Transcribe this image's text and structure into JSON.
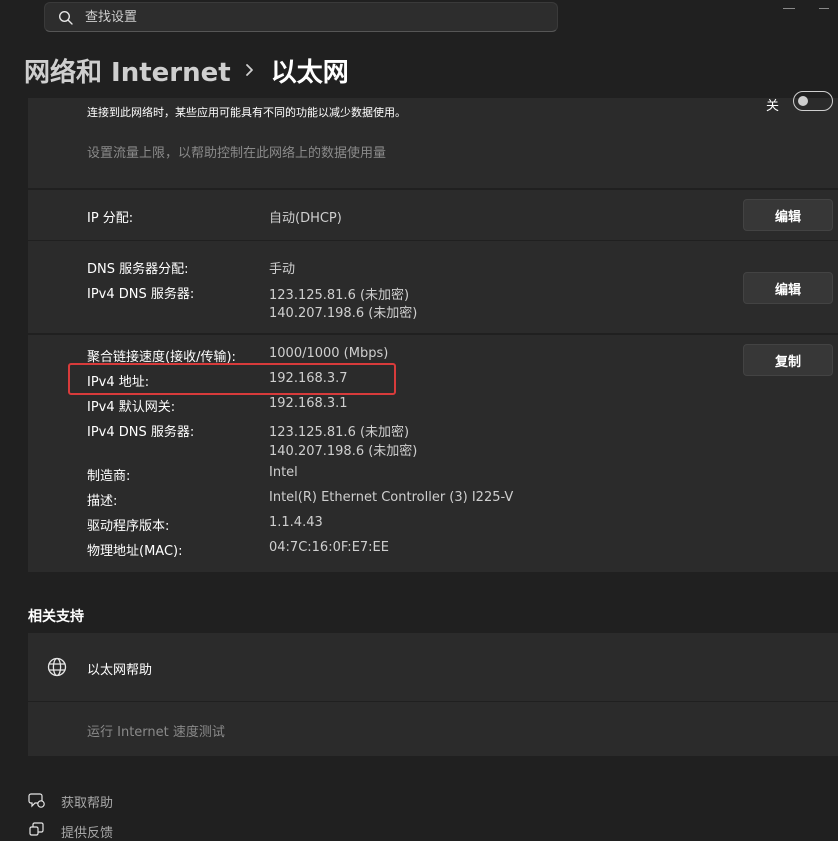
{
  "search": {
    "placeholder": "查找设置",
    "icon": "search-icon"
  },
  "breadcrumb": {
    "parent": "网络和 Internet",
    "separator_icon": "chevron-right-icon",
    "current": "以太网"
  },
  "metered": {
    "description": "连接到此网络时，某些应用可能具有不同的功能以减少数据使用。",
    "toggle_state_label": "关",
    "toggle_on": false,
    "data_limit_link": "设置流量上限，以帮助控制在此网络上的数据使用量"
  },
  "ip_assignment": {
    "label": "IP 分配:",
    "value": "自动(DHCP)",
    "edit_label": "编辑"
  },
  "dns_assignment": {
    "label": "DNS 服务器分配:",
    "value": "手动",
    "ipv4_dns_label": "IPv4 DNS 服务器:",
    "ipv4_dns_values": [
      "123.125.81.6 (未加密)",
      "140.207.198.6 (未加密)"
    ],
    "edit_label": "编辑"
  },
  "properties": {
    "copy_label": "复制",
    "highlight_color": "#d83b3b",
    "rows": [
      {
        "label": "聚合链接速度(接收/传输):",
        "value": "1000/1000 (Mbps)"
      },
      {
        "label": "IPv4 地址:",
        "value": "192.168.3.7"
      },
      {
        "label": "IPv4 默认网关:",
        "value": "192.168.3.1"
      },
      {
        "label": "IPv4 DNS 服务器:",
        "value": "123.125.81.6 (未加密)",
        "value2": "140.207.198.6 (未加密)"
      },
      {
        "label": "制造商:",
        "value": "Intel"
      },
      {
        "label": "描述:",
        "value": "Intel(R) Ethernet Controller (3) I225-V"
      },
      {
        "label": "驱动程序版本:",
        "value": "1.1.4.43"
      },
      {
        "label": "物理地址(MAC):",
        "value": "04:7C:16:0F:E7:EE"
      }
    ]
  },
  "related_support": {
    "title": "相关支持",
    "help_item": {
      "icon": "globe-icon",
      "label": "以太网帮助"
    },
    "speed_test_link": "运行 Internet 速度测试"
  },
  "footer": {
    "get_help": {
      "icon": "help-chat-icon",
      "label": "获取帮助"
    },
    "feedback": {
      "icon": "feedback-icon",
      "label": "提供反馈"
    }
  }
}
